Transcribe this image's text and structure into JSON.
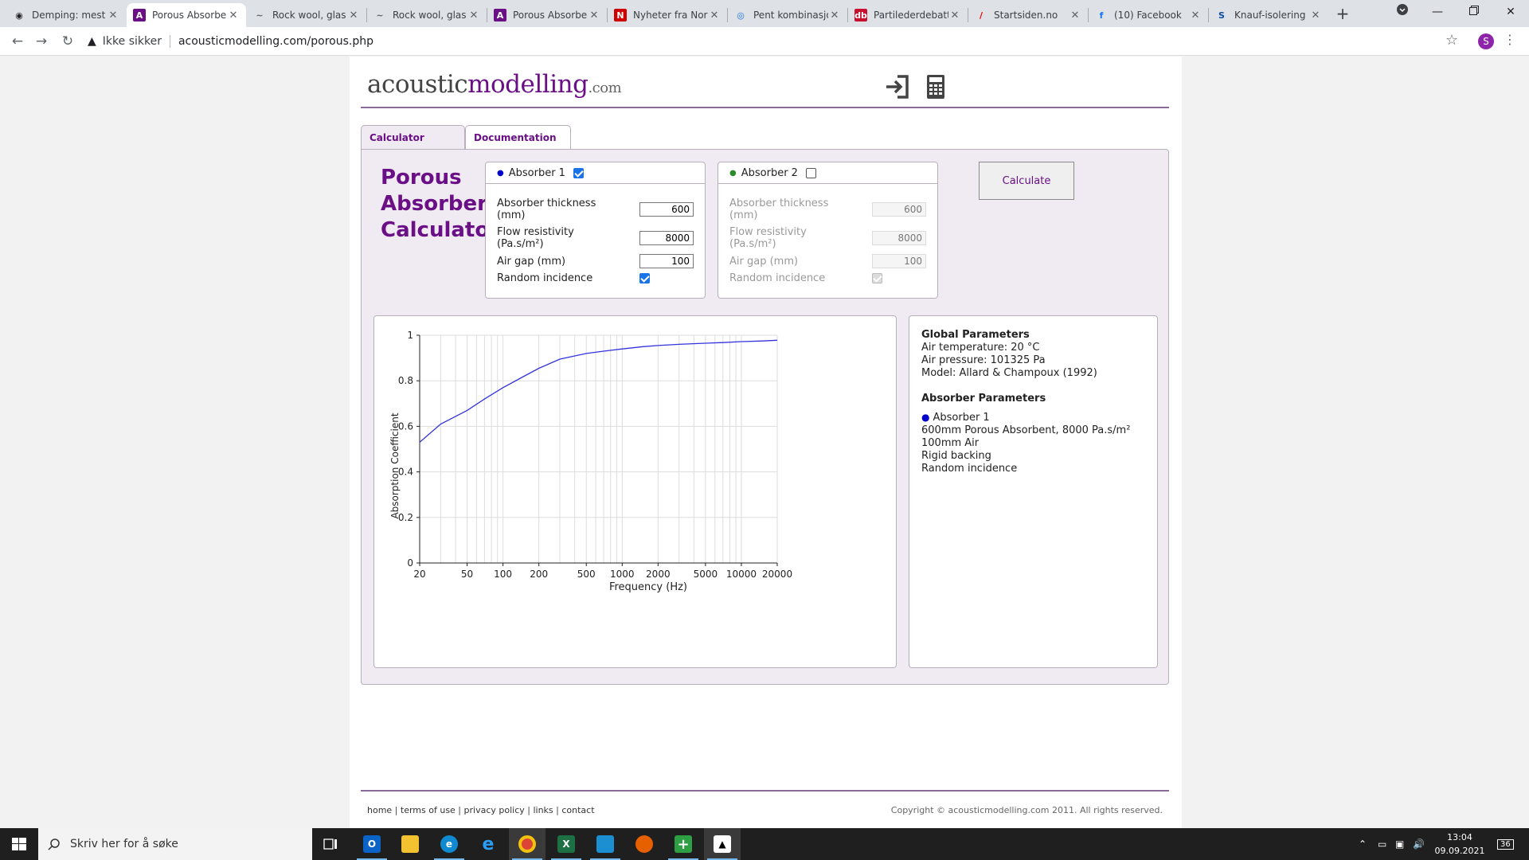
{
  "browser": {
    "tabs": [
      {
        "title": "Demping: mest",
        "icon": "circle-logo-icon",
        "color": "#202124",
        "active": false
      },
      {
        "title": "Porous Absorber",
        "icon": "a-logo-icon",
        "color": "#6a0f86",
        "active": true
      },
      {
        "title": "Rock wool, glas",
        "icon": "wave-icon",
        "color": "#5f6368",
        "active": false
      },
      {
        "title": "Rock wool, glas",
        "icon": "wave-icon",
        "color": "#5f6368",
        "active": false
      },
      {
        "title": "Porous Absorbe",
        "icon": "a-logo-icon",
        "color": "#6a0f86",
        "active": false
      },
      {
        "title": "Nyheter fra Nor",
        "icon": "news-logo-icon",
        "color": "#d00000",
        "active": false
      },
      {
        "title": "Pent kombinasjo",
        "icon": "map-pin-icon",
        "color": "#1a73e8",
        "active": false
      },
      {
        "title": "Partilederdebatt",
        "icon": "db-logo-icon",
        "color": "#c8102e",
        "active": false
      },
      {
        "title": "Startsiden.no",
        "icon": "slash-logo-icon",
        "color": "#e60000",
        "active": false
      },
      {
        "title": "(10) Facebook",
        "icon": "facebook-icon",
        "color": "#1877f2",
        "active": false
      },
      {
        "title": "Knauf-isolering",
        "icon": "s-logo-icon",
        "color": "#0a4da2",
        "active": false
      }
    ],
    "security_label": "Ikke sikker",
    "url": "acousticmodelling.com/porous.php",
    "profile_initial": "S"
  },
  "site": {
    "logo_part1": "acoustic",
    "logo_part2": "modelling",
    "logo_part3": ".com",
    "tabs": [
      "Calculator",
      "Documentation"
    ],
    "title_lines": [
      "Porous",
      "Absorber",
      "Calculator"
    ]
  },
  "absorber1": {
    "label": "Absorber 1",
    "checked": true,
    "thickness_label_1": "Absorber thickness",
    "thickness_label_2": "(mm)",
    "thickness": "600",
    "flow_label_1": "Flow resistivity",
    "flow_label_2": "(Pa.s/m²)",
    "flow": "8000",
    "airgap_label": "Air gap (mm)",
    "airgap": "100",
    "random_label": "Random incidence",
    "random": true
  },
  "absorber2": {
    "label": "Absorber 2",
    "checked": false,
    "thickness_label_1": "Absorber thickness",
    "thickness_label_2": "(mm)",
    "thickness": "600",
    "flow_label_1": "Flow resistivity",
    "flow_label_2": "(Pa.s/m²)",
    "flow": "8000",
    "airgap_label": "Air gap (mm)",
    "airgap": "100",
    "random_label": "Random incidence",
    "random": true
  },
  "calculate_label": "Calculate",
  "info": {
    "global_title": "Global Parameters",
    "global_lines": [
      "Air temperature: 20 °C",
      "Air pressure: 101325 Pa",
      "Model: Allard & Champoux (1992)"
    ],
    "absorber_title": "Absorber Parameters",
    "absorber_name": "Absorber 1",
    "absorber_lines": [
      "600mm Porous Absorbent, 8000 Pa.s/m²",
      "100mm Air",
      "Rigid backing",
      "Random incidence"
    ]
  },
  "chart_data": {
    "type": "line",
    "xlabel": "Frequency (Hz)",
    "ylabel": "Absorption Coefficient",
    "xscale": "log",
    "xlim": [
      20,
      20000
    ],
    "ylim": [
      0,
      1
    ],
    "xticks": [
      20,
      50,
      100,
      200,
      500,
      1000,
      2000,
      5000,
      10000,
      20000
    ],
    "xtick_labels": [
      "20",
      "50",
      "100",
      "200",
      "500",
      "1000",
      "2000",
      "5000",
      "10000",
      "20000"
    ],
    "yticks": [
      0,
      0.2,
      0.4,
      0.6,
      0.8,
      1
    ],
    "ytick_labels": [
      "0",
      "0.2",
      "0.4",
      "0.6",
      "0.8",
      "1"
    ],
    "grid": true,
    "line_color": "#3333dd",
    "series": [
      {
        "x": [
          20,
          30,
          50,
          70,
          100,
          150,
          200,
          300,
          500,
          700,
          1000,
          1500,
          2000,
          3000,
          5000,
          7000,
          10000,
          15000,
          20000
        ],
        "y": [
          0.53,
          0.61,
          0.67,
          0.72,
          0.77,
          0.82,
          0.855,
          0.895,
          0.92,
          0.93,
          0.94,
          0.95,
          0.955,
          0.96,
          0.965,
          0.968,
          0.972,
          0.975,
          0.978
        ]
      }
    ]
  },
  "footer": {
    "links": [
      "home",
      "terms of use",
      "privacy policy",
      "links",
      "contact"
    ],
    "copyright": "Copyright © acousticmodelling.com 2011. All rights reserved."
  },
  "taskbar": {
    "search_placeholder": "Skriv her for å søke",
    "time": "13:04",
    "date": "09.09.2021",
    "notification_count": "36"
  }
}
